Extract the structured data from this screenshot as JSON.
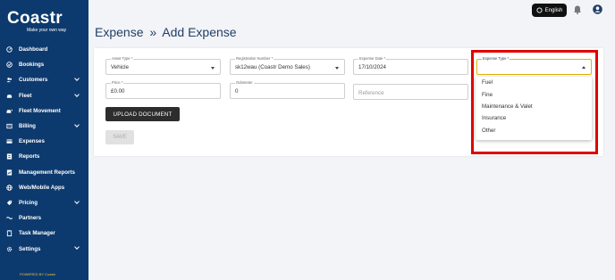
{
  "brand": {
    "name": "Coastr",
    "tagline": "Make your own way",
    "powered_by": "POWERED BY Coastr"
  },
  "sidebar": {
    "items": [
      {
        "label": "Dashboard",
        "icon": "dashboard-icon",
        "chevron": false
      },
      {
        "label": "Bookings",
        "icon": "bookings-icon",
        "chevron": false
      },
      {
        "label": "Customers",
        "icon": "customers-icon",
        "chevron": true
      },
      {
        "label": "Fleet",
        "icon": "car-icon",
        "chevron": true
      },
      {
        "label": "Fleet Movement",
        "icon": "fleet-movement-icon",
        "chevron": false
      },
      {
        "label": "Billing",
        "icon": "billing-icon",
        "chevron": true
      },
      {
        "label": "Expenses",
        "icon": "expenses-icon",
        "chevron": false
      },
      {
        "label": "Reports",
        "icon": "reports-icon",
        "chevron": false
      },
      {
        "label": "Management Reports",
        "icon": "management-reports-icon",
        "chevron": false
      },
      {
        "label": "Web/Mobile Apps",
        "icon": "globe-icon",
        "chevron": false
      },
      {
        "label": "Pricing",
        "icon": "pricing-icon",
        "chevron": true
      },
      {
        "label": "Partners",
        "icon": "partners-icon",
        "chevron": false
      },
      {
        "label": "Task Manager",
        "icon": "task-manager-icon",
        "chevron": false
      },
      {
        "label": "Settings",
        "icon": "gear-icon",
        "chevron": true
      }
    ]
  },
  "topbar": {
    "language": "English"
  },
  "page": {
    "title": "Expense",
    "separator": "»",
    "subtitle": "Add Expense"
  },
  "form": {
    "asset_type": {
      "label": "Asset Type *",
      "value": "Vehicle"
    },
    "registration_number": {
      "label": "Registration Number *",
      "value": "sk12wau (Coastr Demo Sales)"
    },
    "expense_date": {
      "label": "Expense Date *",
      "value": "17/10/2024"
    },
    "expense_type": {
      "label": "Expense Type *",
      "value": ""
    },
    "price": {
      "label": "Price *",
      "value": "£0.00"
    },
    "odometer": {
      "label": "Odometer",
      "value": "0"
    },
    "reference": {
      "placeholder": "Reference"
    },
    "upload_label": "UPLOAD DOCUMENT",
    "save_label": "SAVE"
  },
  "expense_type_options": [
    "Fuel",
    "Fine",
    "Maintenance & Valet",
    "Insurance",
    "Other"
  ],
  "colors": {
    "sidebar_bg": "#0d3a6e",
    "highlight": "#e00000",
    "focus": "#e2b300"
  }
}
